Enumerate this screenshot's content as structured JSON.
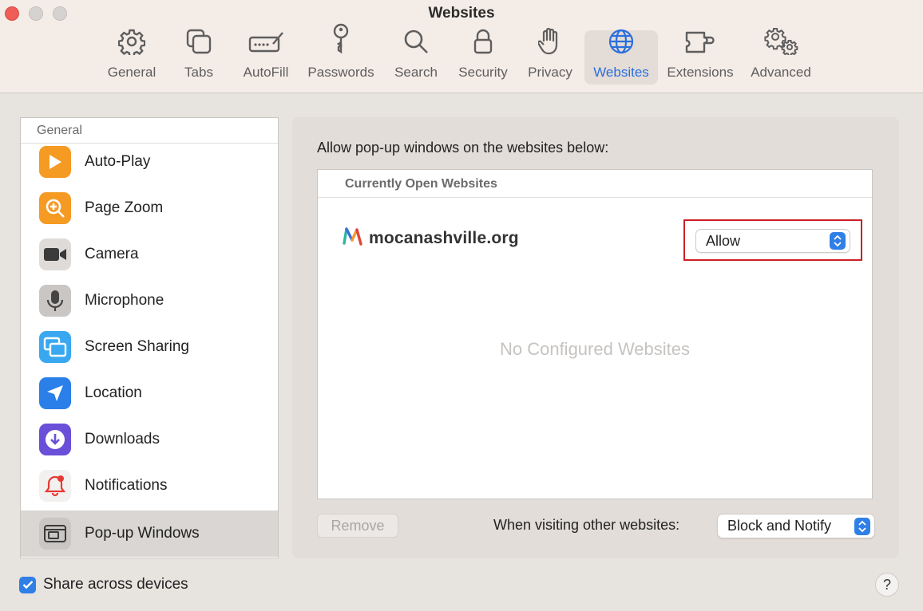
{
  "window": {
    "title": "Websites",
    "traffic_lights": [
      "close",
      "minimize",
      "zoom"
    ]
  },
  "toolbar": {
    "tabs": [
      {
        "label": "General",
        "icon": "gear-icon"
      },
      {
        "label": "Tabs",
        "icon": "tabs-icon"
      },
      {
        "label": "AutoFill",
        "icon": "autofill-icon"
      },
      {
        "label": "Passwords",
        "icon": "key-icon"
      },
      {
        "label": "Search",
        "icon": "magnifier-icon"
      },
      {
        "label": "Security",
        "icon": "lock-icon"
      },
      {
        "label": "Privacy",
        "icon": "hand-icon"
      },
      {
        "label": "Websites",
        "icon": "globe-icon",
        "active": true
      },
      {
        "label": "Extensions",
        "icon": "puzzle-icon"
      },
      {
        "label": "Advanced",
        "icon": "gears-icon"
      }
    ],
    "active_color": "#2a6fdb"
  },
  "sidebar": {
    "header": "General",
    "items": [
      {
        "label": "Auto-Play",
        "icon": "play-icon",
        "color": "#f59a23"
      },
      {
        "label": "Page Zoom",
        "icon": "zoom-icon",
        "color": "#f59a23"
      },
      {
        "label": "Camera",
        "icon": "camera-icon",
        "color": "#4a4a4a"
      },
      {
        "label": "Microphone",
        "icon": "microphone-icon",
        "color": "#8a8a8a"
      },
      {
        "label": "Screen Sharing",
        "icon": "screen-sharing-icon",
        "color": "#39a8f0"
      },
      {
        "label": "Location",
        "icon": "location-arrow-icon",
        "color": "#2a7fe8"
      },
      {
        "label": "Downloads",
        "icon": "download-icon",
        "color": "#6a4fd8"
      },
      {
        "label": "Notifications",
        "icon": "bell-icon",
        "color": "#e53935"
      },
      {
        "label": "Pop-up Windows",
        "icon": "popup-window-icon",
        "color": "#8a8a8a",
        "selected": true
      }
    ]
  },
  "main": {
    "prompt": "Allow pop-up windows on the websites below:",
    "list_header": "Currently Open Websites",
    "site": {
      "name": "mocanashville.org",
      "setting": "Allow"
    },
    "empty_message": "No Configured Websites",
    "remove_label": "Remove",
    "other_label": "When visiting other websites:",
    "other_value": "Block and Notify",
    "highlight_color": "#cc1f26"
  },
  "footer": {
    "share_label": "Share across devices",
    "share_checked": true,
    "help_label": "?"
  }
}
